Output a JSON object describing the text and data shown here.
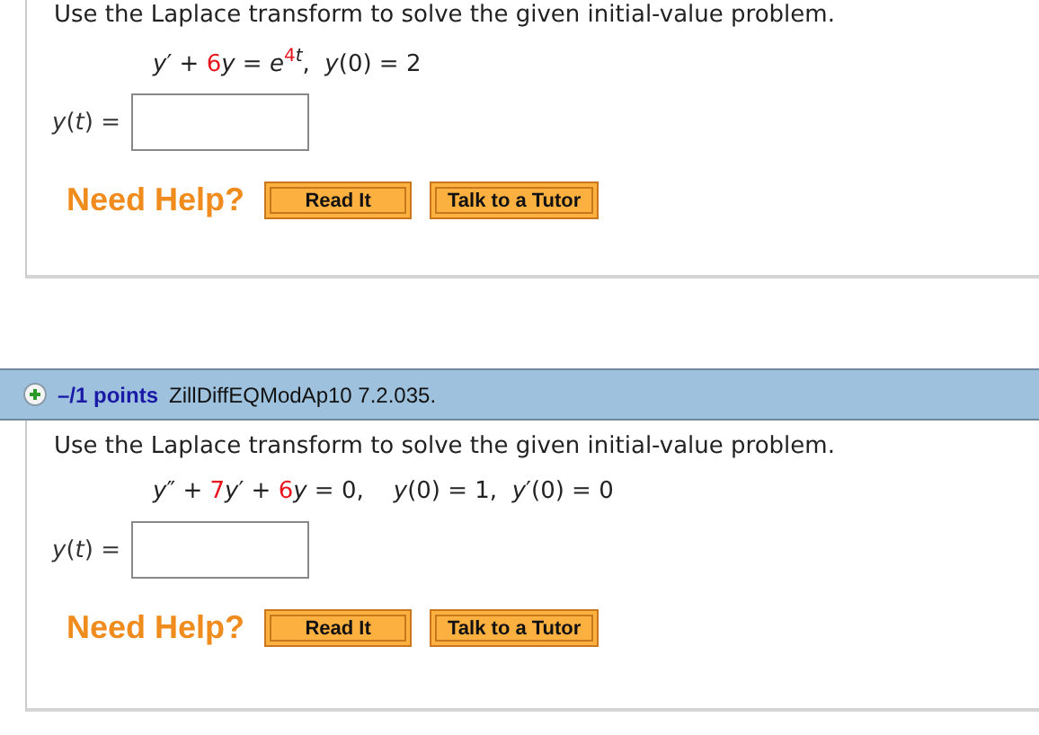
{
  "questions": [
    {
      "prompt": "Use the Laplace transform to solve the given initial-value problem.",
      "equation": [
        {
          "text": "*y*′ + ",
          "highlighted": false,
          "raised": false
        },
        {
          "text": "6",
          "highlighted": true,
          "raised": false
        },
        {
          "text": "*y* = *e*",
          "highlighted": false,
          "raised": false
        },
        {
          "text": "4",
          "highlighted": true,
          "raised": true
        },
        {
          "text": "*t*",
          "highlighted": false,
          "raised": true
        },
        {
          "text": ",  *y*(0) = 2",
          "highlighted": false,
          "raised": false
        }
      ],
      "answer_label": "*y*(*t*) =",
      "help_label": "Need Help?",
      "buttons": [
        "Read It",
        "Talk to a Tutor"
      ]
    },
    {
      "header": {
        "points": "–/1 points",
        "source": "ZillDiffEQModAp10 7.2.035."
      },
      "prompt": "Use the Laplace transform to solve the given initial-value problem.",
      "equation": [
        {
          "text": "*y*″ + ",
          "highlighted": false,
          "raised": false
        },
        {
          "text": "7",
          "highlighted": true,
          "raised": false
        },
        {
          "text": "*y*′ + ",
          "highlighted": false,
          "raised": false
        },
        {
          "text": "6",
          "highlighted": true,
          "raised": false
        },
        {
          "text": "*y* = 0,    *y*(0) = 1,  *y*′(0) = 0",
          "highlighted": false,
          "raised": false
        }
      ],
      "answer_label": "*y*(*t*) =",
      "help_label": "Need Help?",
      "buttons": [
        "Read It",
        "Talk to a Tutor"
      ]
    }
  ]
}
